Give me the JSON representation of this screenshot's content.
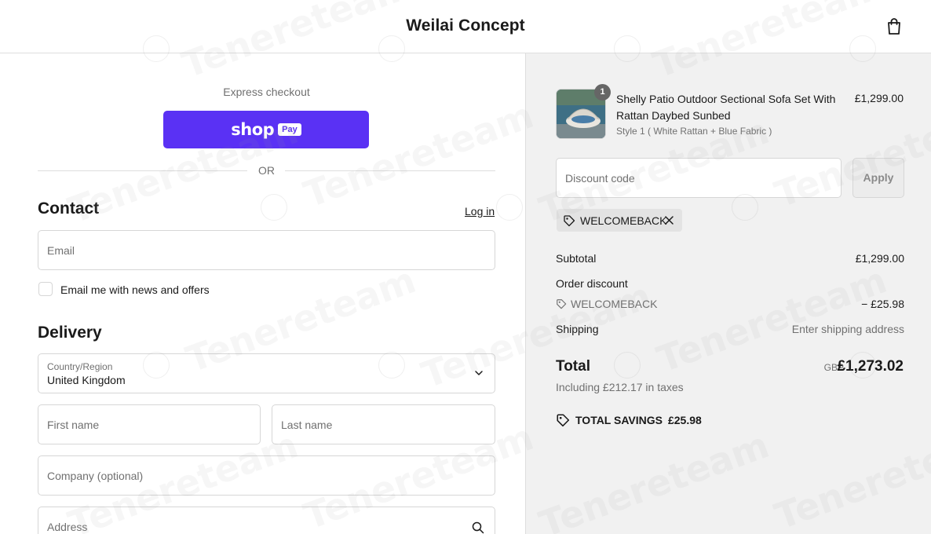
{
  "header": {
    "brand": "Weilai Concept",
    "cart_icon": "shopping-bag-icon"
  },
  "express": {
    "label": "Express checkout",
    "shop_word": "shop",
    "pay_pill": "Pay",
    "divider": "OR"
  },
  "contact": {
    "title": "Contact",
    "login": "Log in",
    "email_placeholder": "Email",
    "news_checkbox_label": "Email me with news and offers",
    "news_checked": false
  },
  "delivery": {
    "title": "Delivery",
    "country_label": "Country/Region",
    "country_value": "United Kingdom",
    "first_name_placeholder": "First name",
    "last_name_placeholder": "Last name",
    "company_placeholder": "Company (optional)",
    "address_placeholder": "Address"
  },
  "summary": {
    "product": {
      "name": "Shelly Patio Outdoor Sectional Sofa Set With Rattan Daybed Sunbed",
      "variant": "Style 1 ( White Rattan + Blue Fabric )",
      "price": "£1,299.00",
      "quantity": "1"
    },
    "discount_placeholder": "Discount code",
    "apply_label": "Apply",
    "applied_code": "WELCOMEBACK",
    "subtotal_label": "Subtotal",
    "subtotal_value": "£1,299.00",
    "order_discount_label": "Order discount",
    "order_discount_code": "WELCOMEBACK",
    "order_discount_value": "− £25.98",
    "shipping_label": "Shipping",
    "shipping_value": "Enter shipping address",
    "total_label": "Total",
    "currency": "GBP",
    "total_value": "£1,273.02",
    "taxes_note": "Including £212.17 in taxes",
    "savings_label": "TOTAL SAVINGS",
    "savings_value": "£25.98"
  },
  "watermark": "Tenereteam",
  "colors": {
    "shop_pay": "#5a31f4",
    "summary_bg": "#f1f1f1"
  }
}
